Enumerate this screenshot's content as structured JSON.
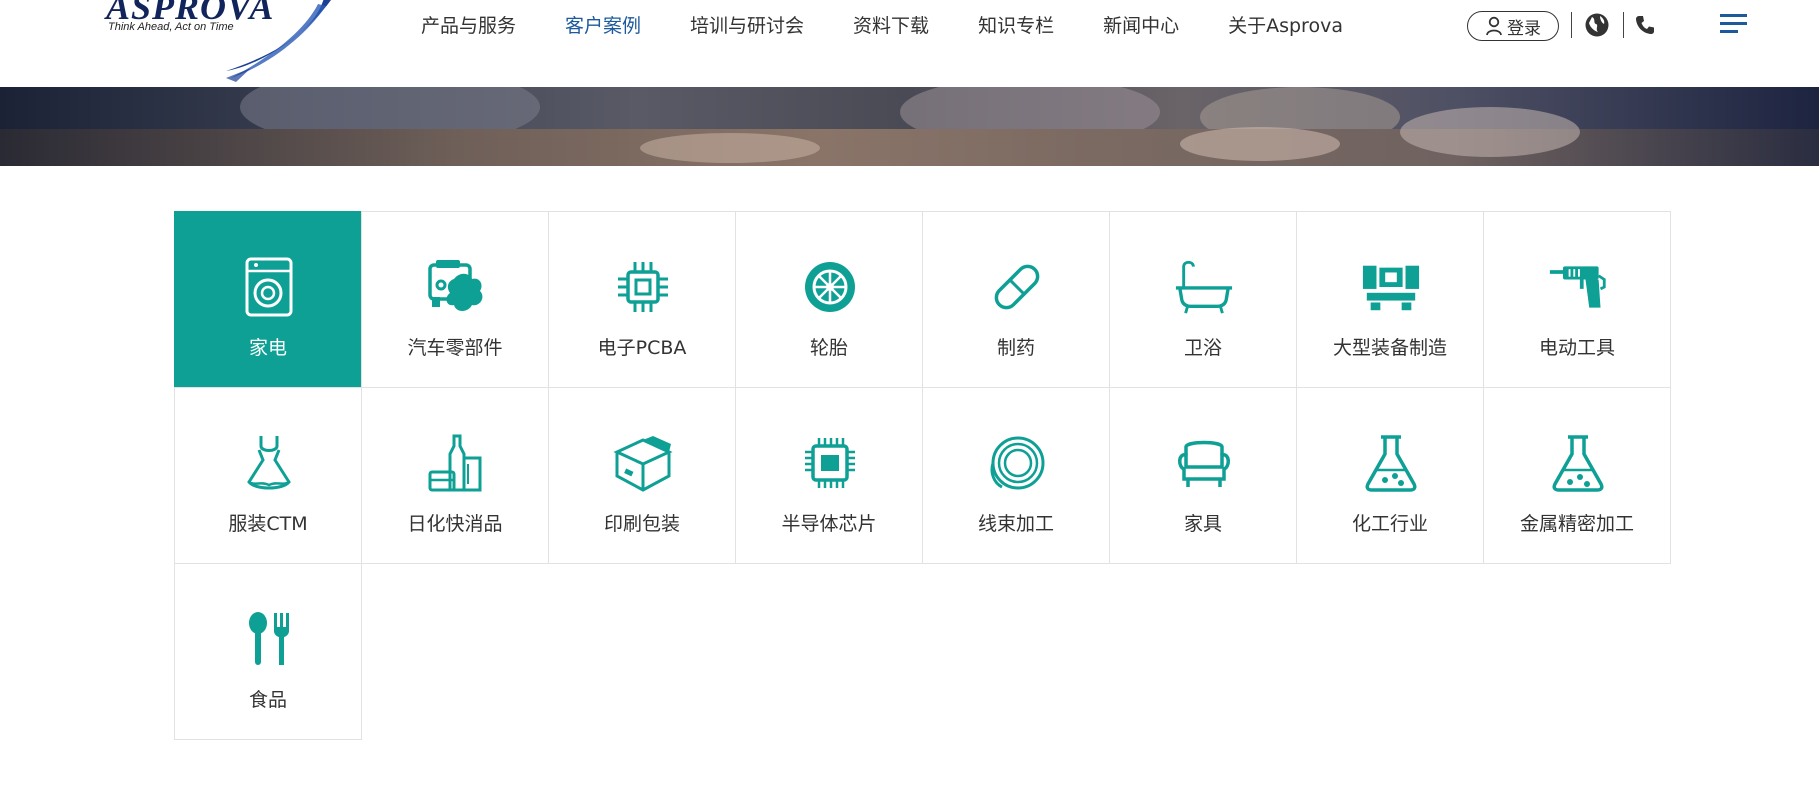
{
  "brand": {
    "name": "ASPROVA",
    "slogan": "Think Ahead, Act on Time"
  },
  "nav": [
    {
      "label": "产品与服务",
      "active": false
    },
    {
      "label": "客户案例",
      "active": true
    },
    {
      "label": "培训与研讨会",
      "active": false
    },
    {
      "label": "资料下载",
      "active": false
    },
    {
      "label": "知识专栏",
      "active": false
    },
    {
      "label": "新闻中心",
      "active": false
    },
    {
      "label": "关于Asprova",
      "active": false
    }
  ],
  "header_actions": {
    "login_label": "登录",
    "icons": [
      "user-icon",
      "globe-icon",
      "phone-icon",
      "hamburger-menu-icon"
    ]
  },
  "colors": {
    "accent": "#0ea095",
    "nav_active": "#1c5a9c",
    "text": "#333333",
    "border": "#e2e2e2"
  },
  "industries": [
    {
      "label": "家电",
      "icon": "washing-machine-icon",
      "active": true
    },
    {
      "label": "汽车零部件",
      "icon": "car-engine-icon",
      "active": false
    },
    {
      "label": "电子PCBA",
      "icon": "chip-icon",
      "active": false
    },
    {
      "label": "轮胎",
      "icon": "tire-icon",
      "active": false
    },
    {
      "label": "制药",
      "icon": "pill-icon",
      "active": false
    },
    {
      "label": "卫浴",
      "icon": "bathtub-icon",
      "active": false
    },
    {
      "label": "大型装备制造",
      "icon": "heavy-machine-icon",
      "active": false
    },
    {
      "label": "电动工具",
      "icon": "power-drill-icon",
      "active": false
    },
    {
      "label": "服装CTM",
      "icon": "dress-icon",
      "active": false
    },
    {
      "label": "日化快消品",
      "icon": "cosmetics-icon",
      "active": false
    },
    {
      "label": "印刷包装",
      "icon": "package-box-icon",
      "active": false
    },
    {
      "label": "半导体芯片",
      "icon": "semiconductor-icon",
      "active": false
    },
    {
      "label": "线束加工",
      "icon": "wire-coil-icon",
      "active": false
    },
    {
      "label": "家具",
      "icon": "armchair-icon",
      "active": false
    },
    {
      "label": "化工行业",
      "icon": "flask-icon",
      "active": false
    },
    {
      "label": "金属精密加工",
      "icon": "flask-precision-icon",
      "active": false
    },
    {
      "label": "食品",
      "icon": "spoon-fork-icon",
      "active": false
    }
  ]
}
